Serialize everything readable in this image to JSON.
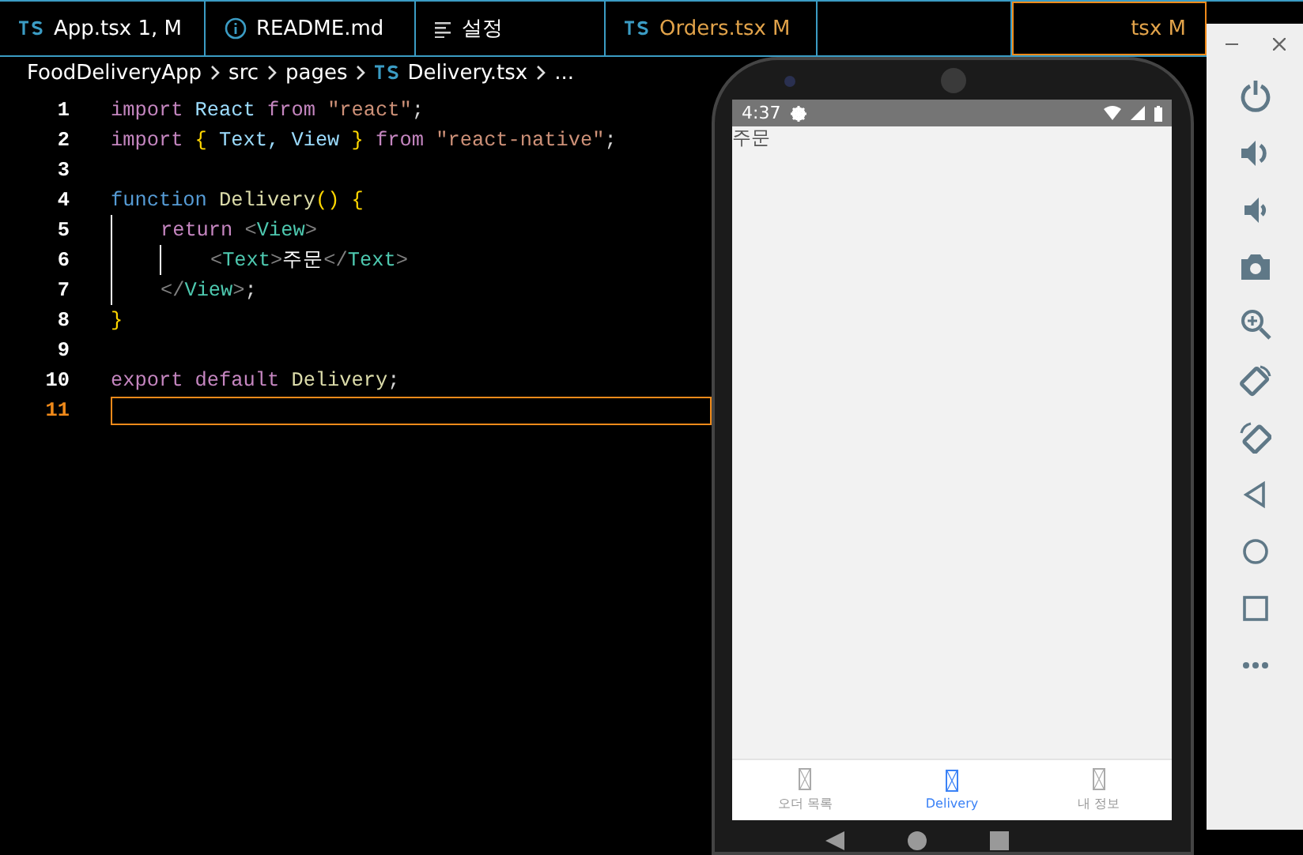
{
  "editor": {
    "tabs": [
      {
        "label": "App.tsx 1, M",
        "kind": "typescript",
        "color": "#ffffff",
        "selected": false
      },
      {
        "label": "README.md",
        "kind": "markdown",
        "color": "#ffffff",
        "selected": false
      },
      {
        "label": "설정",
        "kind": "settings",
        "color": "#ffffff",
        "selected": false
      },
      {
        "label": "Orders.tsx M",
        "kind": "typescript",
        "color": "#e2a34a",
        "selected": false
      },
      {
        "label": "tsx M",
        "kind": "partial",
        "color": "#e2a34a",
        "selected": true
      }
    ],
    "breadcrumb": [
      {
        "label": "FoodDeliveryApp",
        "kind": "folder"
      },
      {
        "label": "src",
        "kind": "folder"
      },
      {
        "label": "pages",
        "kind": "folder"
      },
      {
        "label": "Delivery.tsx",
        "kind": "typescript"
      },
      {
        "label": "...",
        "kind": "folder"
      }
    ],
    "lines": [
      {
        "number": "1",
        "current": false,
        "tokens": [
          {
            "text": "import",
            "color": "#c586c0"
          },
          {
            "text": " React",
            "color": "#9cdcfe"
          },
          {
            "text": " from",
            "color": "#c586c0"
          },
          {
            "text": " \"react\"",
            "color": "#ce9178"
          },
          {
            "text": ";",
            "color": "#d4d4d4"
          }
        ]
      },
      {
        "number": "2",
        "current": false,
        "tokens": [
          {
            "text": "import",
            "color": "#c586c0"
          },
          {
            "text": " {",
            "color": "#ffd700"
          },
          {
            "text": " Text, View",
            "color": "#9cdcfe"
          },
          {
            "text": " }",
            "color": "#ffd700"
          },
          {
            "text": " from",
            "color": "#c586c0"
          },
          {
            "text": " \"react-native\"",
            "color": "#ce9178"
          },
          {
            "text": ";",
            "color": "#d4d4d4"
          }
        ]
      },
      {
        "number": "3",
        "current": false
      },
      {
        "number": "4",
        "current": false,
        "tokens": [
          {
            "text": "function",
            "color": "#569cd6"
          },
          {
            "text": " Delivery",
            "color": "#dcdcaa"
          },
          {
            "text": "()",
            "color": "#ffd700"
          },
          {
            "text": " {",
            "color": "#ffd700"
          }
        ]
      },
      {
        "number": "5",
        "current": false,
        "tokens": [
          {
            "text": "    return",
            "color": "#c586c0"
          },
          {
            "text": " <",
            "color": "#808080"
          },
          {
            "text": "View",
            "color": "#4ec9b0"
          },
          {
            "text": ">",
            "color": "#808080"
          }
        ]
      },
      {
        "number": "6",
        "current": false,
        "tokens": [
          {
            "text": "        <",
            "color": "#808080"
          },
          {
            "text": "Text",
            "color": "#4ec9b0"
          },
          {
            "text": ">",
            "color": "#808080"
          },
          {
            "text": "주문",
            "color": "#ffffff"
          },
          {
            "text": "</",
            "color": "#808080"
          },
          {
            "text": "Text",
            "color": "#4ec9b0"
          },
          {
            "text": ">",
            "color": "#808080"
          }
        ]
      },
      {
        "number": "7",
        "current": false,
        "tokens": [
          {
            "text": "    </",
            "color": "#808080"
          },
          {
            "text": "View",
            "color": "#4ec9b0"
          },
          {
            "text": ">",
            "color": "#808080"
          },
          {
            "text": ";",
            "color": "#d4d4d4"
          }
        ]
      },
      {
        "number": "8",
        "current": false,
        "tokens": [
          {
            "text": "}",
            "color": "#ffd700"
          }
        ]
      },
      {
        "number": "9",
        "current": false
      },
      {
        "number": "10",
        "current": false,
        "tokens": [
          {
            "text": "export default",
            "color": "#c586c0"
          },
          {
            "text": " Delivery",
            "color": "#dcdcaa"
          },
          {
            "text": ";",
            "color": "#d4d4d4"
          }
        ]
      },
      {
        "number": "11",
        "current": true
      }
    ]
  },
  "phone": {
    "status_bar": {
      "time": "4:37"
    },
    "content_text": "주문",
    "bottom_tabs": [
      {
        "label": "오더 목록",
        "selected": false
      },
      {
        "label": "Delivery",
        "selected": true
      },
      {
        "label": "내 정보",
        "selected": false
      }
    ]
  }
}
